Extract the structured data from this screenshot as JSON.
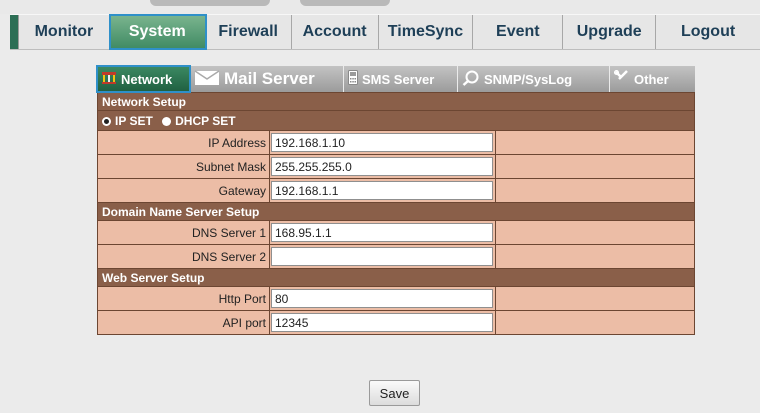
{
  "nav": {
    "items": [
      {
        "label": "Monitor"
      },
      {
        "label": "System"
      },
      {
        "label": "Firewall"
      },
      {
        "label": "Account"
      },
      {
        "label": "TimeSync"
      },
      {
        "label": "Event"
      },
      {
        "label": "Upgrade"
      },
      {
        "label": "Logout"
      }
    ],
    "active": "System"
  },
  "subtabs": [
    {
      "label": "Network",
      "icon": "network-icon"
    },
    {
      "label": "Mail Server",
      "icon": "mail-icon"
    },
    {
      "label": "SMS Server",
      "icon": "sms-icon"
    },
    {
      "label": "SNMP/SysLog",
      "icon": "search-icon"
    },
    {
      "label": "Other",
      "icon": "wrench-icon"
    }
  ],
  "network": {
    "section_title": "Network Setup",
    "ip_set_label": "IP SET",
    "dhcp_set_label": "DHCP SET",
    "selected_mode": "IP SET",
    "ip_address_label": "IP Address",
    "ip_address": "192.168.1.10",
    "subnet_mask_label": "Subnet Mask",
    "subnet_mask": "255.255.255.0",
    "gateway_label": "Gateway",
    "gateway": "192.168.1.1"
  },
  "dns": {
    "section_title": "Domain Name Server Setup",
    "dns1_label": "DNS Server 1",
    "dns1": "168.95.1.1",
    "dns2_label": "DNS Server 2",
    "dns2": ""
  },
  "web": {
    "section_title": "Web Server Setup",
    "http_port_label": "Http Port",
    "http_port": "80",
    "api_port_label": "API port",
    "api_port": "12345"
  },
  "save_label": "Save",
  "colors": {
    "section_bg": "#8a5f49",
    "field_bg": "#ecbda6",
    "active_tab": "#3f8a63",
    "nav_text": "#1e3f57",
    "focus_outline": "#2f90c9"
  }
}
